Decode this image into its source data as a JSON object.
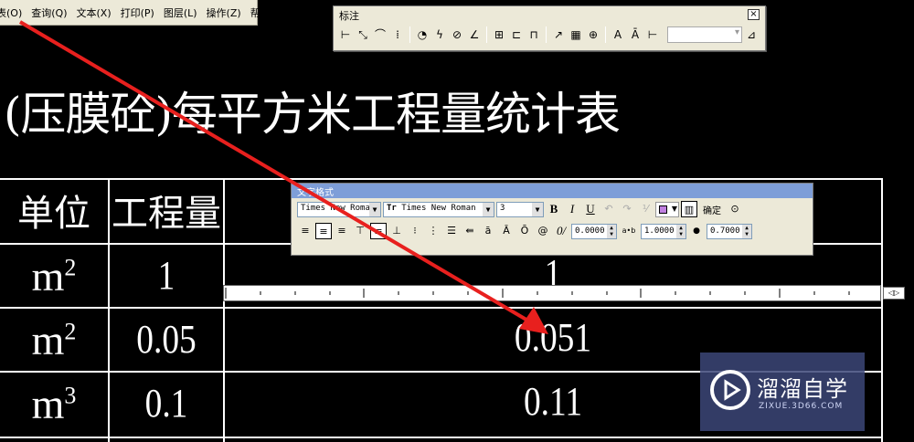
{
  "menubar": {
    "items": [
      "视图(O)",
      "查询(Q)",
      "文本(X)",
      "打印(P)",
      "图层(L)",
      "操作(Z)",
      "帮助(H)"
    ],
    "first_visible": "表(O)"
  },
  "drawing": {
    "title": "(压膜砼)每平方米工程量统计表",
    "headers": [
      "单位",
      "工程量"
    ],
    "rows": [
      {
        "unit_base": "m",
        "unit_exp": "2",
        "qty": "1",
        "edit": "1"
      },
      {
        "unit_base": "m",
        "unit_exp": "2",
        "qty": "0.05",
        "edit": "0.051"
      },
      {
        "unit_base": "m",
        "unit_exp": "3",
        "qty": "0.1",
        "edit": "0.11"
      }
    ]
  },
  "dim_toolbar": {
    "title": "标注",
    "close": "×"
  },
  "text_format": {
    "title": "文字格式",
    "style": "Times New Roman",
    "font": "Times New Roman",
    "font_icon": "Tr",
    "height": "3",
    "bold": "B",
    "italic": "I",
    "underline": "U",
    "ok": "确定",
    "oblique": "0.0000",
    "tracking": "1.0000",
    "width": "0.7000",
    "labels": {
      "oblique": "0/",
      "tracking": "a•b",
      "width": "●"
    }
  },
  "watermark": {
    "name": "溜溜自学",
    "url": "ZIXUE.3D66.COM"
  },
  "colors": {
    "annotation_arrow": "#e8201e",
    "text_color_swatch": "#c080e0",
    "background": "#000000"
  }
}
